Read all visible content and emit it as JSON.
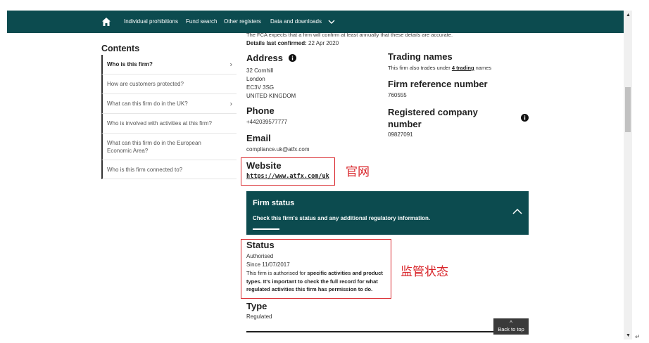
{
  "nav": {
    "items": [
      "Individual prohibitions",
      "Fund search",
      "Other registers",
      "Data and downloads"
    ]
  },
  "intro": {
    "truncated_text": "The FCA expects that a firm will confirm at least annually that these details are accurate.",
    "last_confirmed_label": "Details last confirmed:",
    "last_confirmed_value": "22 Apr 2020"
  },
  "contents": {
    "title": "Contents",
    "items": [
      "Who is this firm?",
      "How are customers protected?",
      "What can this firm do in the UK?",
      "Who is involved with activities at this firm?",
      "What can this firm do in the European Economic Area?",
      "Who is this firm connected to?"
    ]
  },
  "address": {
    "title": "Address",
    "lines": [
      "32 Cornhill",
      "London",
      "EC3V 3SG",
      "UNITED KINGDOM"
    ]
  },
  "phone": {
    "title": "Phone",
    "value": "+442039577777"
  },
  "email": {
    "title": "Email",
    "value": "compliance.uk@atfx.com"
  },
  "website": {
    "title": "Website",
    "value": "https://www.atfx.com/uk"
  },
  "trading_names": {
    "title": "Trading names",
    "text_before": "This firm also trades under ",
    "link": "4 trading",
    "text_after": " names"
  },
  "frn": {
    "title": "Firm reference number",
    "value": "760555"
  },
  "company_number": {
    "title": "Registered company number",
    "value": "09827091"
  },
  "firm_status": {
    "title": "Firm status",
    "subtitle": "Check this firm's status and any additional regulatory information."
  },
  "status": {
    "title": "Status",
    "value": "Authorised",
    "since": "Since 11/07/2017",
    "desc_normal": "This firm is authorised for ",
    "desc_bold": "specific activities and product types. It's important to check the full record for what regulated activities this firm has permission to do."
  },
  "type": {
    "title": "Type",
    "value": "Regulated"
  },
  "annotations": {
    "website_note": "官网",
    "status_note": "监管状态"
  },
  "back_to_top": "Back to top",
  "colors": {
    "header": "#0c4b4f",
    "annotation_red": "#d9262b"
  }
}
